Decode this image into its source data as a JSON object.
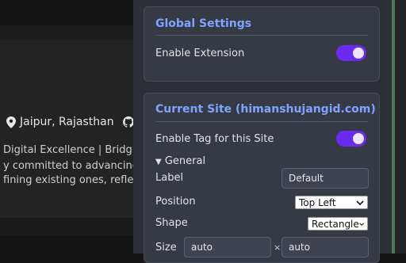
{
  "background": {
    "location": "Jaipur, Rajasthan",
    "line1": "Digital Excellence | Bridging",
    "line2": "y committed to advancing m",
    "line3": "fining existing ones, reflecti"
  },
  "global": {
    "title": "Global Settings",
    "enable_extension_label": "Enable Extension",
    "enable_extension_on": true
  },
  "site": {
    "title": "Current Site (himanshujangid.com)",
    "enable_tag_label": "Enable Tag for this Site",
    "enable_tag_on": true,
    "general_label": "General",
    "label_label": "Label",
    "label_value": "Default",
    "position_label": "Position",
    "position_value": "Top Left",
    "shape_label": "Shape",
    "shape_value": "Rectangle",
    "size_label": "Size",
    "size_width": "auto",
    "size_height": "auto",
    "size_separator": "×"
  },
  "colors": {
    "accent": "#7fa3ff",
    "toggle_on": "#6a2af0",
    "panel_bg": "#2c2f36",
    "card_bg": "#363a44"
  }
}
